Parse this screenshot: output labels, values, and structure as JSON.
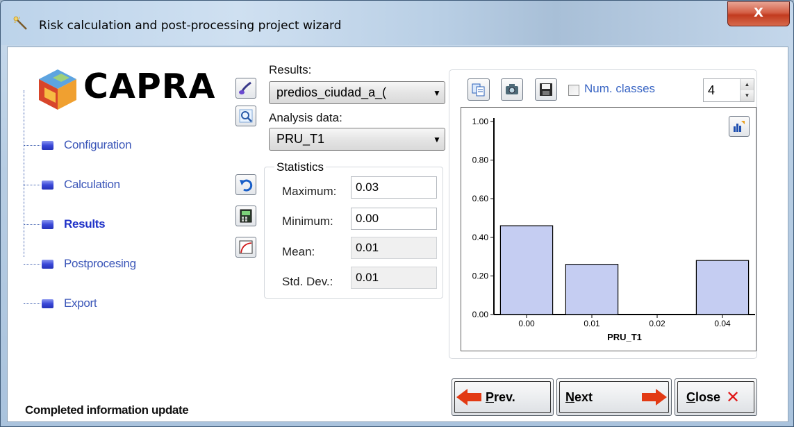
{
  "window": {
    "title": "Risk calculation and post-processing project wizard",
    "close_glyph": "X"
  },
  "logo": {
    "text": "CAPRA"
  },
  "nav": {
    "items": [
      {
        "label": "Configuration"
      },
      {
        "label": "Calculation"
      },
      {
        "label": "Results"
      },
      {
        "label": "Postprocesing"
      },
      {
        "label": "Export"
      }
    ],
    "active": "Results"
  },
  "results": {
    "label": "Results:",
    "selected": "predios_ciudad_a_(",
    "analysis_label": "Analysis data:",
    "analysis_selected": "PRU_T1"
  },
  "statistics": {
    "caption": "Statistics",
    "maximum_label": "Maximum:",
    "maximum": "0.03",
    "minimum_label": "Minimum:",
    "minimum": "0.00",
    "mean_label": "Mean:",
    "mean": "0.01",
    "std_label": "Std. Dev.:",
    "std": "0.01"
  },
  "chart_panel": {
    "num_classes_label": "Num. classes",
    "num_classes": "4",
    "spin_up": "▲",
    "spin_down": "▼"
  },
  "chart_data": {
    "type": "bar",
    "categories": [
      "0.00",
      "0.01",
      "0.02",
      "0.04"
    ],
    "values": [
      0.46,
      0.26,
      0.0,
      0.28
    ],
    "title": "",
    "xlabel": "PRU_T1",
    "ylabel": "",
    "ylim": [
      0,
      1
    ],
    "yticks": [
      "0.00",
      "0.20",
      "0.40",
      "0.60",
      "0.80",
      "1.00"
    ],
    "grid": false,
    "bar_color": "#c5cdf2"
  },
  "footer": {
    "status": "Completed information update",
    "prev_label_u": "P",
    "prev_label_rest": "rev.",
    "next_label_u": "N",
    "next_label_rest": "ext",
    "close_label_u": "C",
    "close_label_rest": "lose",
    "close_glyph": "✕"
  }
}
